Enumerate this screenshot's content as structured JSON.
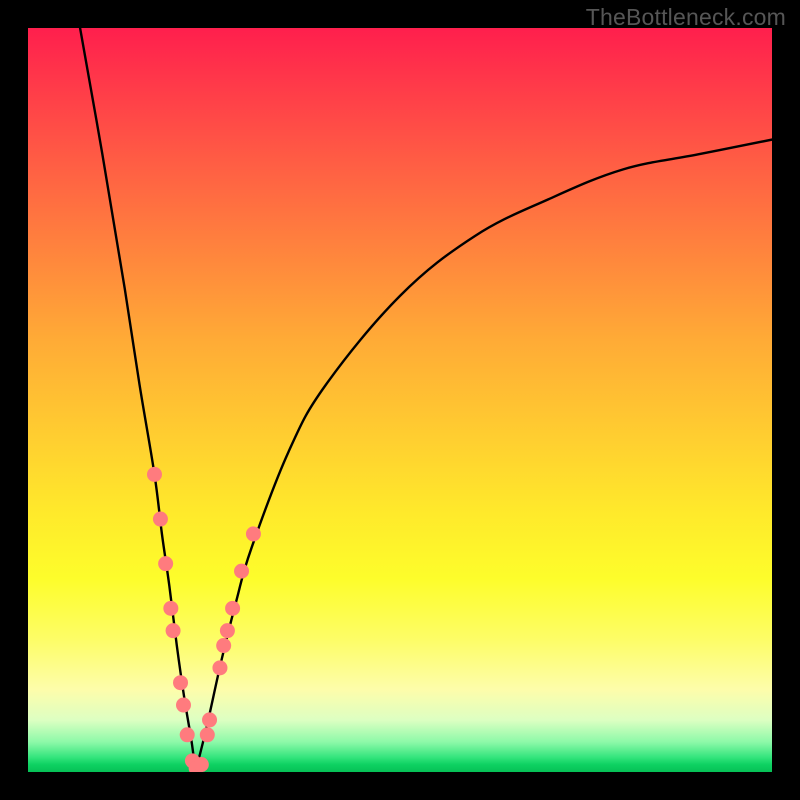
{
  "watermark": {
    "text": "TheBottleneck.com"
  },
  "colors": {
    "background": "#000000",
    "curve_stroke": "#000000",
    "dot_fill": "#ff7b7e",
    "dot_stroke": "#cc5a5d",
    "gradient_top": "#ff1f4d",
    "gradient_bottom": "#06c156"
  },
  "chart_data": {
    "type": "line",
    "title": "",
    "xlabel": "",
    "ylabel": "",
    "xlim": [
      0,
      100
    ],
    "ylim": [
      0,
      100
    ],
    "note": "V-shaped bottleneck curve; y represents mismatch % (0 at bottom = optimal match). Minimum around x ≈ 22.5.",
    "series": [
      {
        "name": "left-branch",
        "x": [
          7,
          10,
          13,
          15,
          17,
          18,
          19,
          20,
          21,
          22,
          22.5
        ],
        "y": [
          100,
          83,
          65,
          52,
          40,
          32,
          25,
          17,
          10,
          4,
          0
        ]
      },
      {
        "name": "right-branch",
        "x": [
          22.5,
          24,
          26,
          28,
          30,
          35,
          40,
          50,
          60,
          70,
          80,
          90,
          100
        ],
        "y": [
          0,
          6,
          15,
          23,
          30,
          43,
          52,
          64,
          72,
          77,
          81,
          83,
          85
        ]
      }
    ],
    "dots": {
      "name": "highlighted-points",
      "points": [
        {
          "x": 17.0,
          "y": 40
        },
        {
          "x": 17.8,
          "y": 34
        },
        {
          "x": 18.5,
          "y": 28
        },
        {
          "x": 19.2,
          "y": 22
        },
        {
          "x": 19.5,
          "y": 19
        },
        {
          "x": 20.5,
          "y": 12
        },
        {
          "x": 20.9,
          "y": 9
        },
        {
          "x": 21.4,
          "y": 5
        },
        {
          "x": 22.1,
          "y": 1.5
        },
        {
          "x": 22.6,
          "y": 0.5
        },
        {
          "x": 23.3,
          "y": 1.0
        },
        {
          "x": 24.1,
          "y": 5
        },
        {
          "x": 24.4,
          "y": 7
        },
        {
          "x": 25.8,
          "y": 14
        },
        {
          "x": 26.3,
          "y": 17
        },
        {
          "x": 26.8,
          "y": 19
        },
        {
          "x": 27.5,
          "y": 22
        },
        {
          "x": 28.7,
          "y": 27
        },
        {
          "x": 30.3,
          "y": 32
        }
      ]
    }
  }
}
